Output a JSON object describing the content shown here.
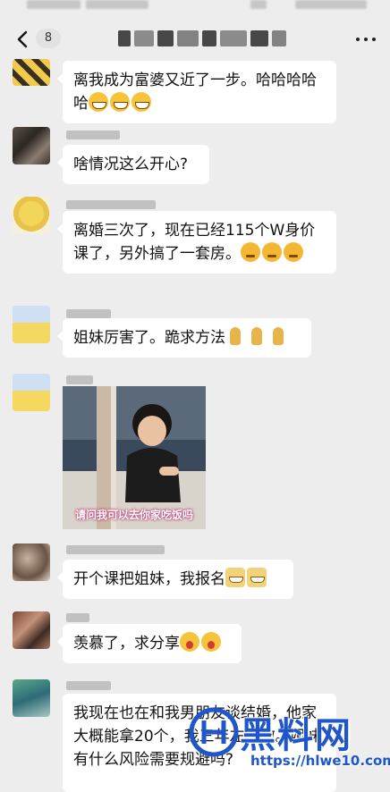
{
  "header": {
    "unread_count": "8"
  },
  "messages": [
    {
      "id": "m1",
      "text": "离我成为富婆又近了一步。哈哈哈哈哈"
    },
    {
      "id": "m2",
      "text": "啥情况这么开心?"
    },
    {
      "id": "m3",
      "text": "离婚三次了，现在已经115个W身价课了，另外搞了一套房。"
    },
    {
      "id": "m4",
      "text": "姐妹厉害了。跪求方法"
    },
    {
      "id": "m5",
      "image_caption": "请问我可以去你家吃饭吗"
    },
    {
      "id": "m6",
      "text": "开个课把姐妹，我报名"
    },
    {
      "id": "m7",
      "text": "羡慕了，求分享"
    },
    {
      "id": "m8",
      "text": "我现在也在和我男朋友谈结婚，他家大概能拿20个，我三年左右撤。姐妹有什么风险需要规避吗?"
    }
  ],
  "watermark": {
    "brand": "黑料网",
    "url": "https://hlwe10.com"
  },
  "colors": {
    "background": "#ededed",
    "bubble": "#ffffff",
    "watermark": "#1f56c9"
  }
}
